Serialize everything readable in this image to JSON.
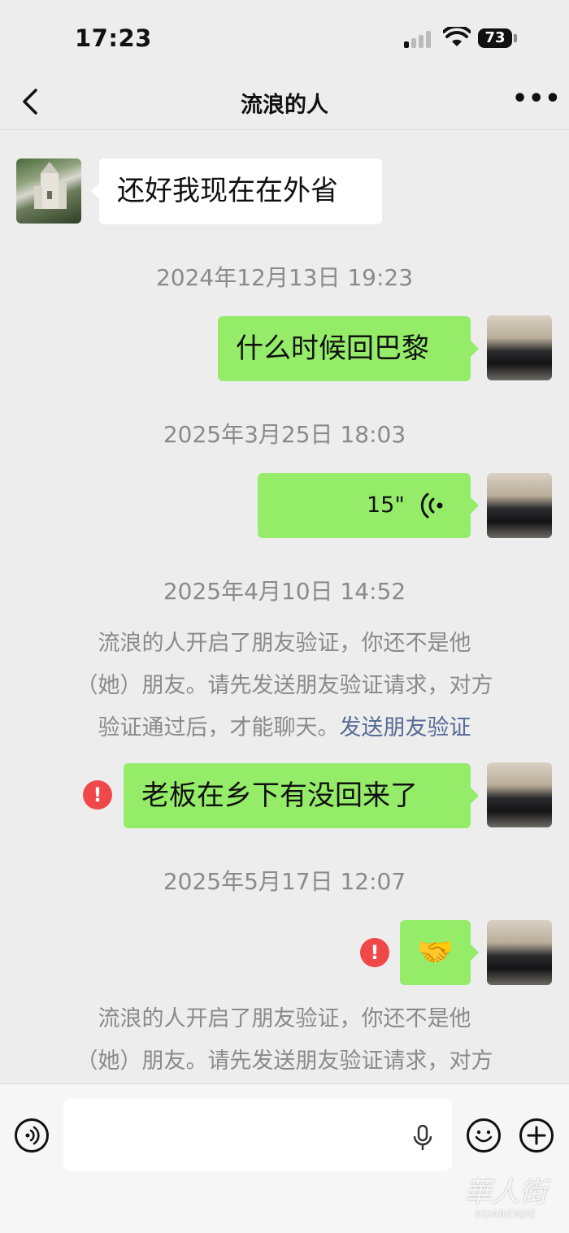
{
  "status_bar": {
    "time": "17:23",
    "battery": "73",
    "icons": [
      "signal-icon",
      "wifi-icon",
      "battery-icon"
    ]
  },
  "header": {
    "title": "流浪的人",
    "back_icon": "chevron-left-icon",
    "more_icon": "more-icon",
    "more_label": "•••"
  },
  "messages": [
    {
      "type": "text",
      "direction": "incoming",
      "text": "还好我现在在外省"
    },
    {
      "type": "timestamp",
      "text": "2024年12月13日 19:23"
    },
    {
      "type": "text",
      "direction": "outgoing",
      "text": "什么时候回巴黎"
    },
    {
      "type": "timestamp",
      "text": "2025年3月25日 18:03"
    },
    {
      "type": "voice",
      "direction": "outgoing",
      "duration": "15\""
    },
    {
      "type": "timestamp",
      "text": "2025年4月10日 14:52"
    },
    {
      "type": "system",
      "text": "流浪的人开启了朋友验证，你还不是他（她）朋友。请先发送朋友验证请求，对方验证通过后，才能聊天。",
      "link": "发送朋友验证"
    },
    {
      "type": "text",
      "direction": "outgoing",
      "text": "老板在乡下有没回来了",
      "failed": true
    },
    {
      "type": "timestamp",
      "text": "2025年5月17日 12:07"
    },
    {
      "type": "emoji",
      "direction": "outgoing",
      "emoji": "🤝",
      "failed": true
    },
    {
      "type": "system",
      "text": "流浪的人开启了朋友验证，你还不是他（她）朋友。请先发送朋友验证请求，对方"
    }
  ],
  "system_lines": {
    "first": [
      "流浪的人开启了朋友验证，你还不是他",
      "（她）朋友。请先发送朋友验证请求，对方",
      "验证通过后，才能聊天。"
    ],
    "second": [
      "流浪的人开启了朋友验证，你还不是他",
      "（她）朋友。请先发送朋友验证请求，对方"
    ]
  },
  "error_mark": "!",
  "input_bar": {
    "value": "",
    "icons": [
      "voice-mode-icon",
      "mic-icon",
      "emoji-icon",
      "plus-icon"
    ]
  },
  "watermark": {
    "top": "華人街",
    "bottom": "HUARENJIE"
  },
  "colors": {
    "background": "#ededed",
    "outgoing_bubble": "#95ec69",
    "incoming_bubble": "#ffffff",
    "timestamp_text": "#8a8a8a",
    "link": "#576b95",
    "error": "#f04848"
  }
}
